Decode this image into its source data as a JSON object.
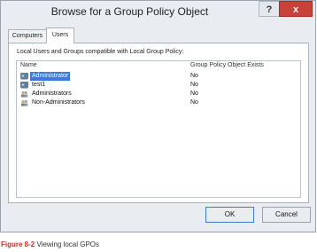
{
  "window": {
    "title": "Browse for a Group Policy Object",
    "help_label": "?",
    "close_label": "x"
  },
  "tabs": [
    {
      "label": "Computers"
    },
    {
      "label": "Users"
    }
  ],
  "panel": {
    "caption": "Local Users and Groups compatible with Local Group Policy:",
    "columns": [
      "Name",
      "Group Policy Object Exists"
    ],
    "rows": [
      {
        "name": "Administrator",
        "gpo_exists": "No",
        "icon": "user-icon",
        "selected": true
      },
      {
        "name": "test1",
        "gpo_exists": "No",
        "icon": "user-icon",
        "selected": false
      },
      {
        "name": "Administrators",
        "gpo_exists": "No",
        "icon": "group-icon",
        "selected": false
      },
      {
        "name": "Non-Administrators",
        "gpo_exists": "No",
        "icon": "group-icon",
        "selected": false
      }
    ]
  },
  "buttons": {
    "ok": "OK",
    "cancel": "Cancel"
  },
  "figure": {
    "label": "Figure 8-2",
    "caption": "Viewing local GPOs"
  },
  "colors": {
    "accent": "#3d7bd6",
    "close": "#c7433a",
    "figure_label": "#c2312b"
  }
}
